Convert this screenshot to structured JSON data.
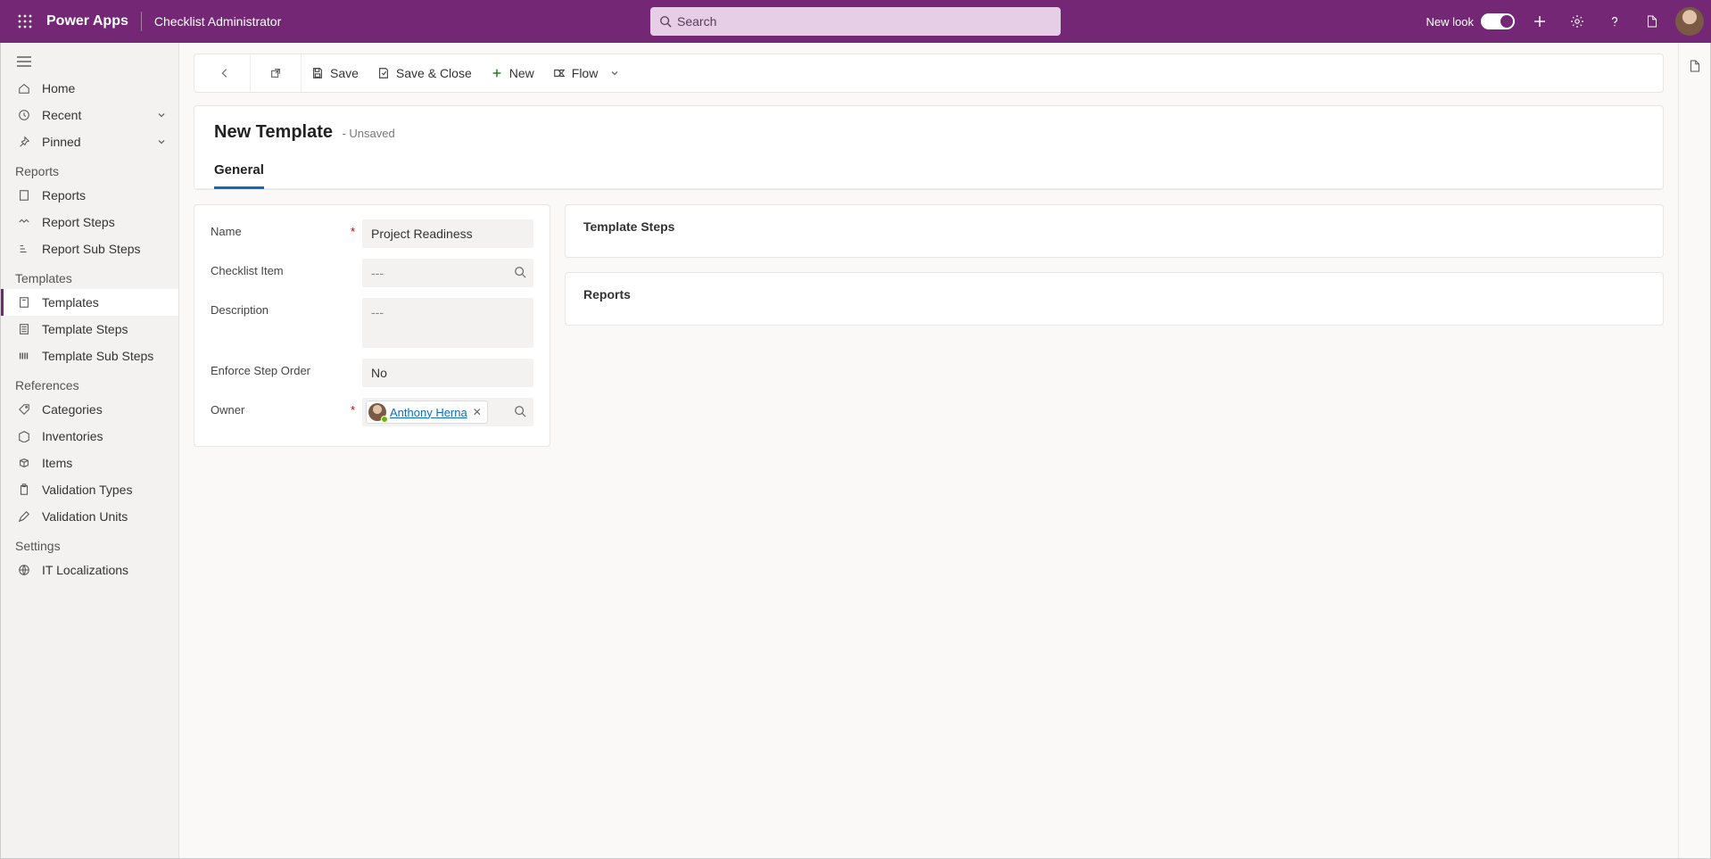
{
  "topbar": {
    "brand": "Power Apps",
    "app_name": "Checklist Administrator",
    "search_placeholder": "Search",
    "newlook_label": "New look"
  },
  "sidebar": {
    "home": "Home",
    "recent": "Recent",
    "pinned": "Pinned",
    "groups": {
      "reports": "Reports",
      "templates": "Templates",
      "references": "References",
      "settings": "Settings"
    },
    "reports_items": [
      "Reports",
      "Report Steps",
      "Report Sub Steps"
    ],
    "templates_items": [
      "Templates",
      "Template Steps",
      "Template Sub Steps"
    ],
    "references_items": [
      "Categories",
      "Inventories",
      "Items",
      "Validation Types",
      "Validation Units"
    ],
    "settings_items": [
      "IT Localizations"
    ]
  },
  "commandbar": {
    "save": "Save",
    "save_close": "Save & Close",
    "new": "New",
    "flow": "Flow"
  },
  "form": {
    "title": "New Template",
    "status": "- Unsaved",
    "tab_general": "General",
    "fields": {
      "name_label": "Name",
      "name_value": "Project Readiness",
      "checklist_label": "Checklist Item",
      "checklist_value": "---",
      "description_label": "Description",
      "description_value": "---",
      "enforce_label": "Enforce Step Order",
      "enforce_value": "No",
      "owner_label": "Owner",
      "owner_value": "Anthony Herna"
    },
    "sections": {
      "template_steps": "Template Steps",
      "reports": "Reports"
    }
  }
}
